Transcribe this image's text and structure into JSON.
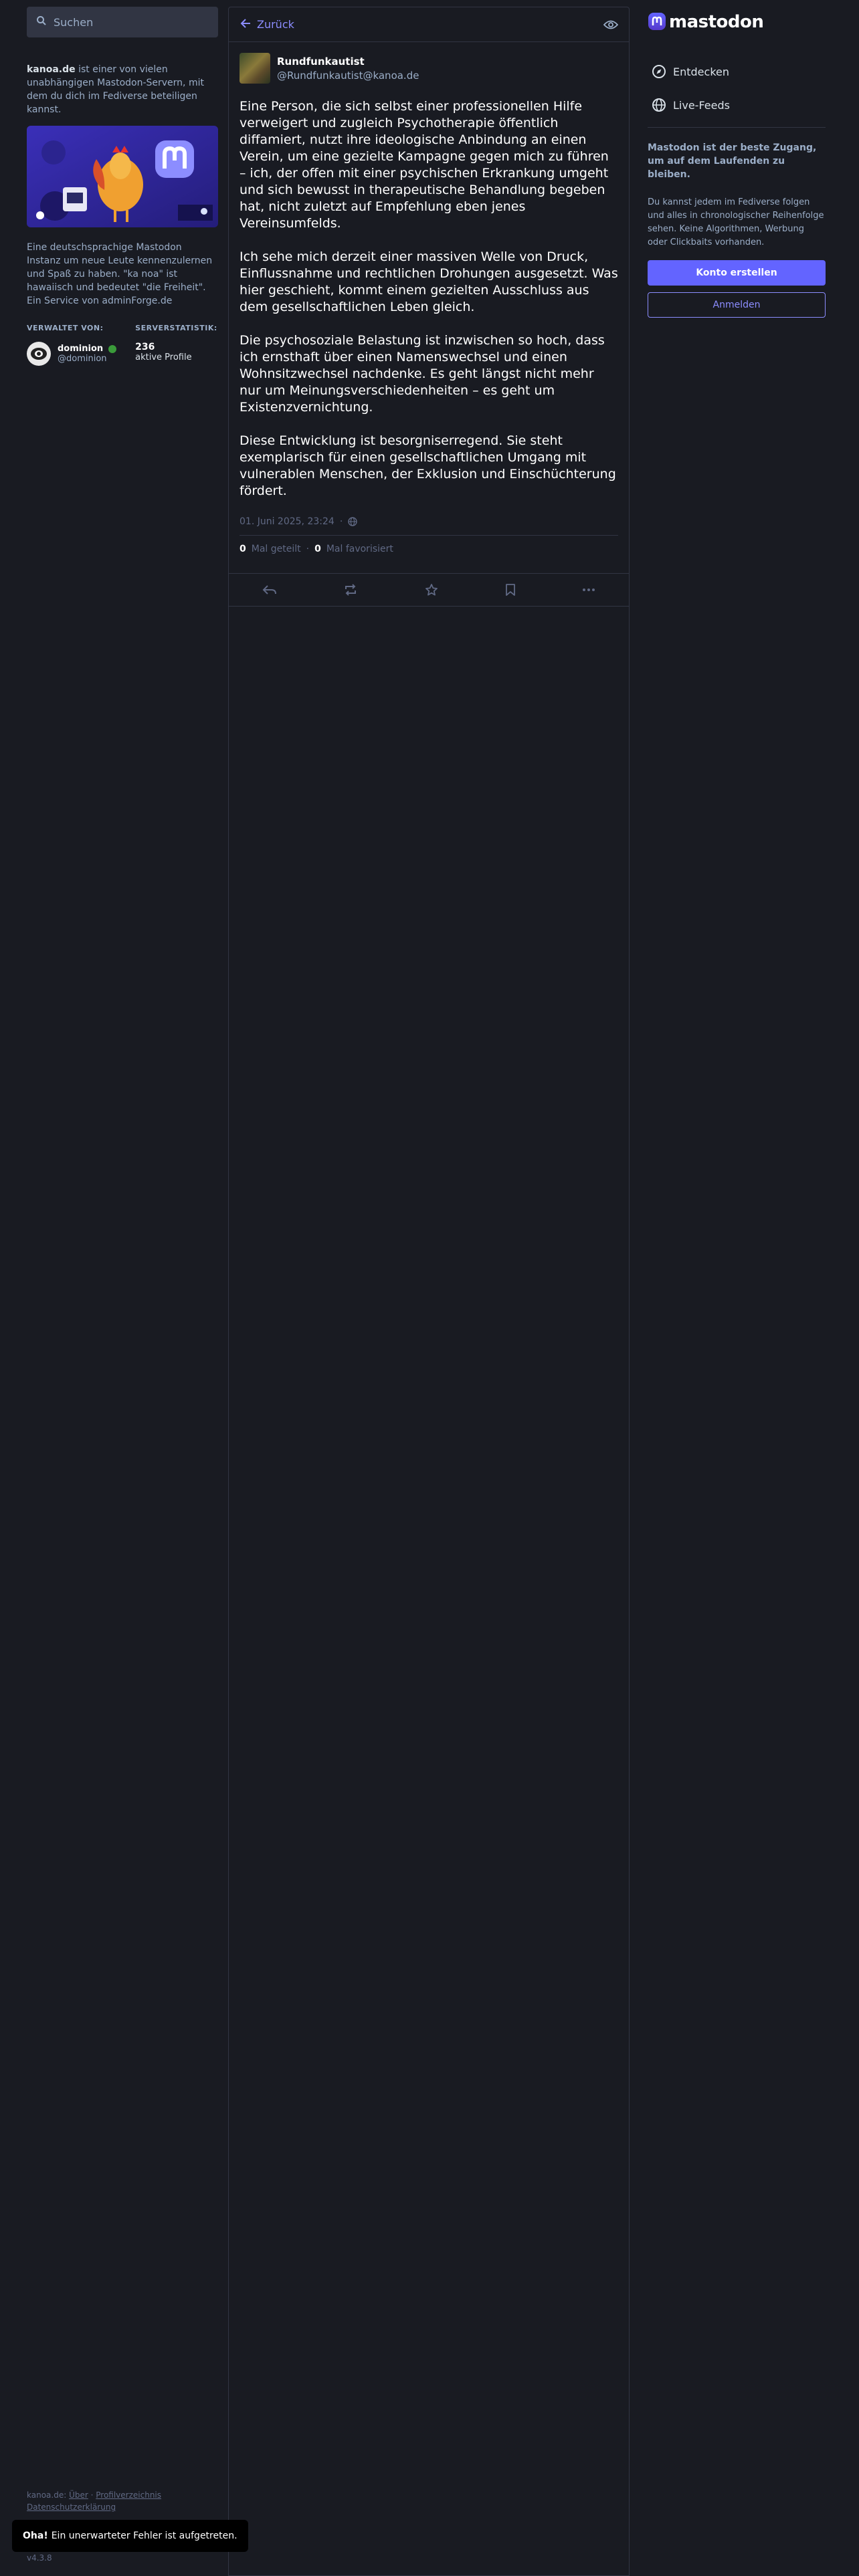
{
  "search": {
    "placeholder": "Suchen"
  },
  "server": {
    "domain": "kanoa.de",
    "intro": "ist einer von vielen unabhängigen Mastodon-Servern, mit dem du dich im Fediverse beteiligen kannst.",
    "description": "Eine deutschsprachige Mastodon Instanz um neue Leute kennenzulernen und Spaß zu haben. \"ka noa\" ist hawaiisch und bedeutet \"die Freiheit\". Ein Service von adminForge.de",
    "administered_by_label": "VERWALTET VON:",
    "stats_label": "SERVERSTATISTIK:",
    "admin_name": "dominion",
    "admin_handle": "@dominion",
    "active_count": "236",
    "active_label": "aktive Profile"
  },
  "footer": {
    "domain": "kanoa.de:",
    "about": "Über",
    "profiles": "Profilverzeichnis",
    "privacy": "Datenschutzerklärung",
    "version": "v4.3.8"
  },
  "header": {
    "back_label": "Zurück"
  },
  "status": {
    "display_name": "Rundfunkautist",
    "handle": "@Rundfunkautist@kanoa.de",
    "paragraphs": [
      "Eine Person, die sich selbst einer professionellen Hilfe verweigert und zugleich Psychotherapie öffentlich diffamiert, nutzt ihre ideologische Anbindung an einen Verein, um eine gezielte Kampagne gegen mich zu führen – ich, der offen mit einer psychischen Erkrankung umgeht und sich bewusst in therapeutische Behandlung begeben hat, nicht zuletzt auf Empfehlung eben jenes Vereinsumfelds.",
      "Ich sehe mich derzeit einer massiven Welle von Druck, Einflussnahme und rechtlichen Drohungen ausgesetzt. Was hier geschieht, kommt einem gezielten Ausschluss aus dem gesellschaftlichen Leben gleich.",
      "Die psychosoziale Belastung ist inzwischen so hoch, dass ich ernsthaft über einen Namenswechsel und einen Wohnsitzwechsel nachdenke. Es geht längst nicht mehr nur um Meinungsverschiedenheiten – es geht um Existenzvernichtung.",
      "Diese Entwicklung ist besorgniserregend. Sie steht exemplarisch für einen gesellschaftlichen Umgang mit vulnerablen Menschen, der Exklusion und Einschüchterung fördert."
    ],
    "timestamp": "01. Juni 2025, 23:24",
    "boosts_count": "0",
    "boosts_label": "Mal geteilt",
    "favs_count": "0",
    "favs_label": "Mal favorisiert"
  },
  "right": {
    "logo_text": "mastodon",
    "nav": [
      {
        "label": "Entdecken",
        "icon": "compass-icon"
      },
      {
        "label": "Live-Feeds",
        "icon": "globe-icon"
      }
    ],
    "signup_heading": "Mastodon ist der beste Zugang, um auf dem Laufenden zu bleiben.",
    "signup_text": "Du kannst jedem im Fediverse folgen und alles in chronologischer Reihenfolge sehen. Keine Algorithmen, Werbung oder Clickbaits vorhanden.",
    "create_account": "Konto erstellen",
    "login": "Anmelden"
  },
  "toast": {
    "strong": "Oha!",
    "message": "Ein unerwarteter Fehler ist aufgetreten."
  },
  "colors": {
    "accent": "#6364ff",
    "link": "#8c8dff",
    "background": "#191b22",
    "muted": "#9baec8"
  }
}
